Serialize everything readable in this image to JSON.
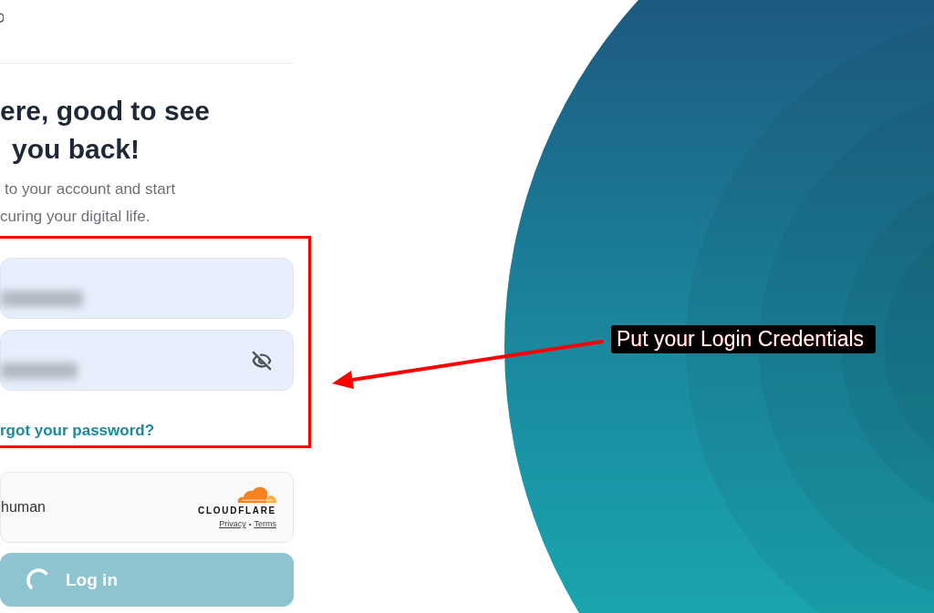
{
  "heading": {
    "lines": [
      "ere, good to see",
      "you back!"
    ]
  },
  "subtitle": {
    "lines": [
      "to your account and start",
      "curing your digital life."
    ]
  },
  "form": {
    "fields": [
      {
        "kind": "email",
        "blurred": true
      },
      {
        "kind": "password",
        "blurred": true
      }
    ],
    "forgot_link": "rgot your password?"
  },
  "captcha": {
    "label": "human",
    "brand": "CLOUDFLARE",
    "links": [
      "Privacy",
      "Terms"
    ],
    "separator": "•"
  },
  "login_button": {
    "label": "Log in",
    "loading": true
  },
  "annotation": {
    "label": "Put your Login Credentials"
  }
}
